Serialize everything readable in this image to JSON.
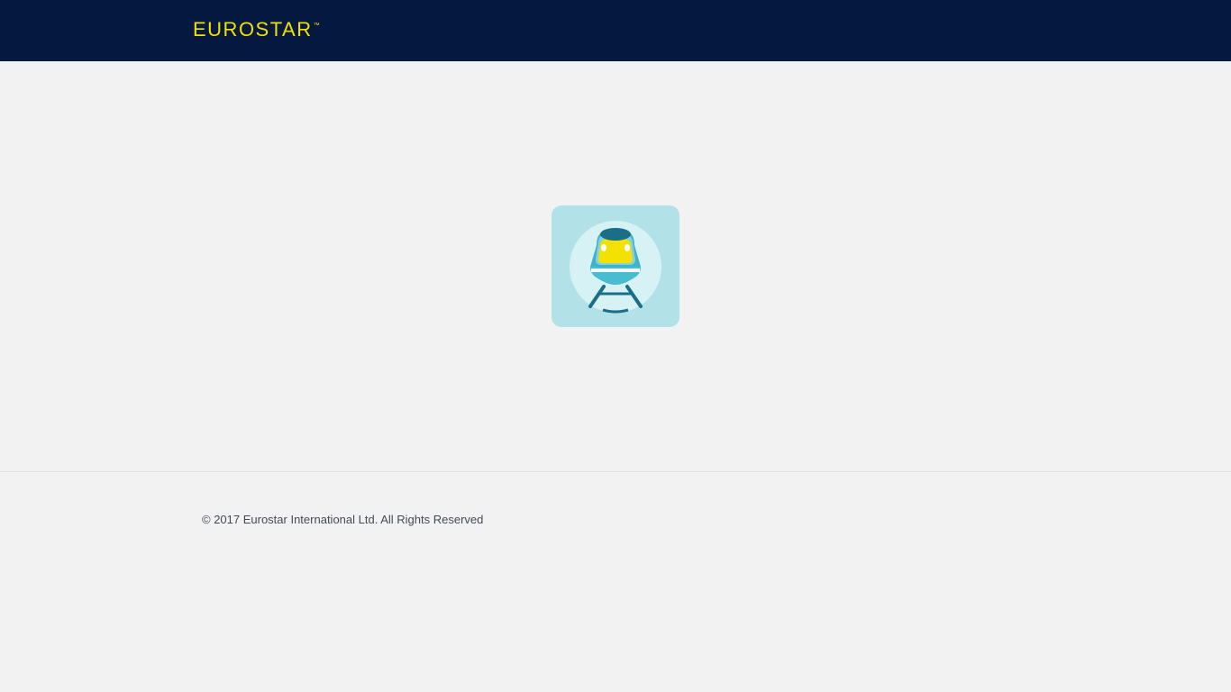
{
  "header": {
    "logo_text": "EUROSTAR",
    "logo_trademark": "™"
  },
  "main": {
    "loading_icon": "train-icon"
  },
  "footer": {
    "copyright": "© 2017 Eurostar International Ltd. All Rights Reserved"
  },
  "colors": {
    "header_bg": "#051840",
    "logo_yellow": "#f1e100",
    "page_bg": "#f2f2f2",
    "tile_bg": "#b2e2e8",
    "train_teal": "#3fb3c9",
    "train_dark": "#1a6e87"
  }
}
